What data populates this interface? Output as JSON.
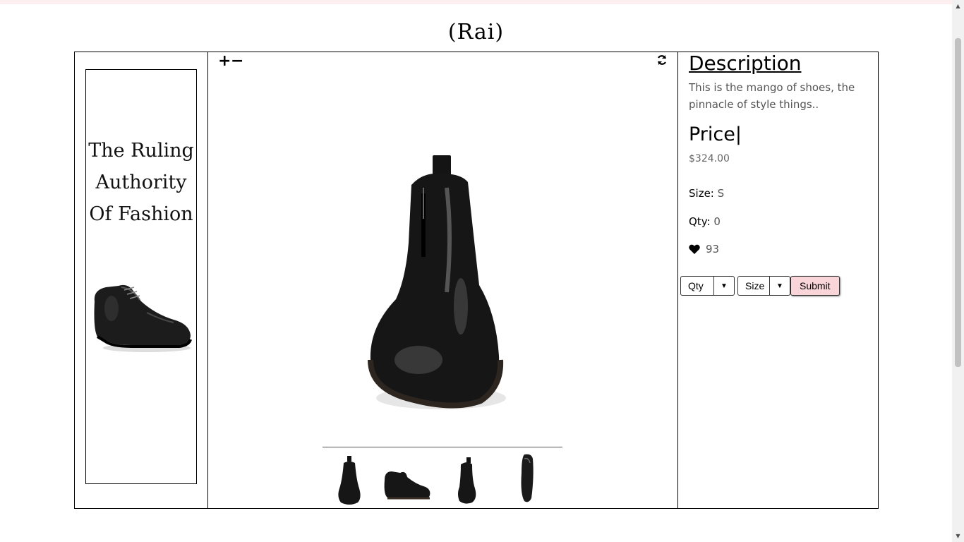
{
  "site": {
    "title": "(Rai)"
  },
  "ad": {
    "tagline": [
      "The Ruling",
      "Authority",
      "Of Fashion"
    ]
  },
  "viewer": {
    "zoom_in": "+",
    "zoom_out": "−",
    "refresh_icon": "refresh-icon"
  },
  "product": {
    "description_heading": "Description",
    "description": "This is the mango of shoes, the pinnacle of style things..",
    "price_heading": "Price|",
    "price": "$324.00",
    "size_label": "Size:",
    "size_value": "S",
    "qty_label": "Qty:",
    "qty_value": "0",
    "likes": "93"
  },
  "form": {
    "qty_dropdown": "Qty",
    "size_dropdown": "Size",
    "submit": "Submit"
  },
  "colors": {
    "submit_bg": "#f9d4d8",
    "top_strip": "#fdeff0"
  }
}
